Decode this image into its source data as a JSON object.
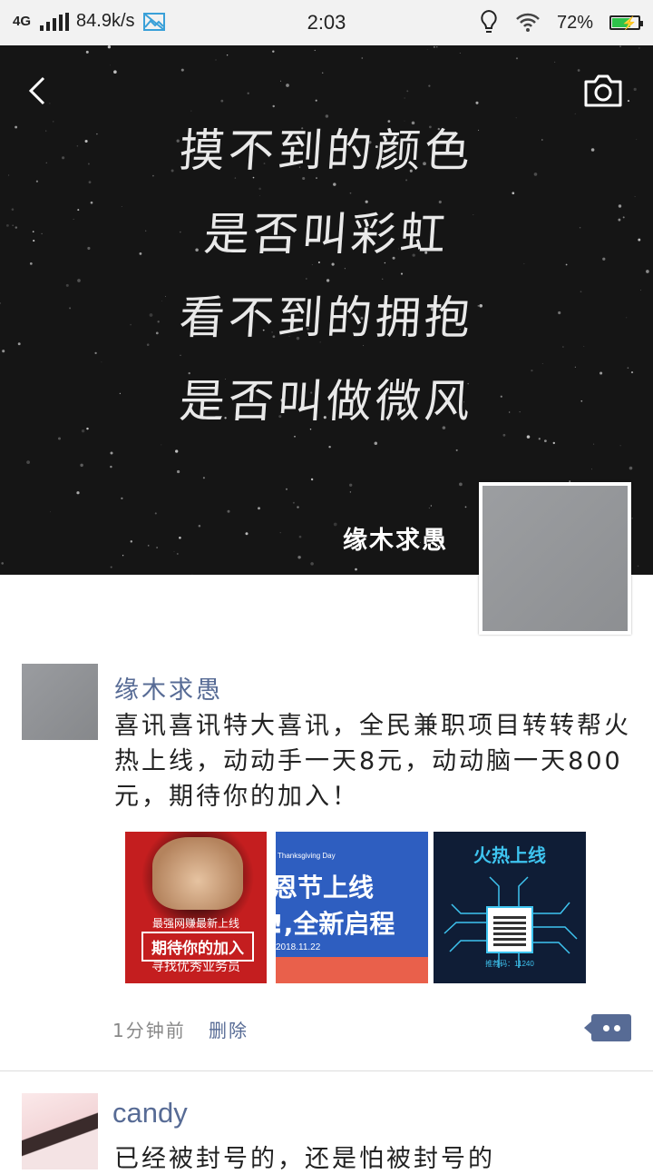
{
  "status_bar": {
    "network": "4G",
    "speed": "84.9k/s",
    "time": "2:03",
    "battery": "72%",
    "battery_level": 0.72,
    "icons": [
      "signal-icon",
      "image-notify-icon",
      "bulb-icon",
      "wifi-icon",
      "battery-icon"
    ]
  },
  "cover": {
    "poem_lines": [
      "摸不到的颜色",
      "是否叫彩虹",
      "看不到的拥抱",
      "是否叫做微风"
    ],
    "display_name": "缘木求愚"
  },
  "posts": [
    {
      "author": "缘木求愚",
      "text": "喜讯喜讯特大喜讯，全民兼职项目转转帮火热上线，动动手一天8元，动动脑一天800元，期待你的加入！",
      "images": [
        {
          "line1": "最强网赚最新上线",
          "line2": "期待你的加入",
          "line3": "寻找优秀业务员"
        },
        {
          "small": "Thanksgiving Day",
          "big1": "恩节上线",
          "big2": "!,全新启程",
          "date": "2018.11.22"
        },
        {
          "heading": "火热上线",
          "caption": "推荐码：11240"
        }
      ],
      "time": "1分钟前",
      "delete_label": "删除"
    },
    {
      "author": "candy",
      "text": "已经被封号的，还是怕被封号的"
    }
  ],
  "colors": {
    "link": "#576b95",
    "statusbar_bg": "#f2f2f2",
    "battery_fill": "#2ec24a"
  }
}
